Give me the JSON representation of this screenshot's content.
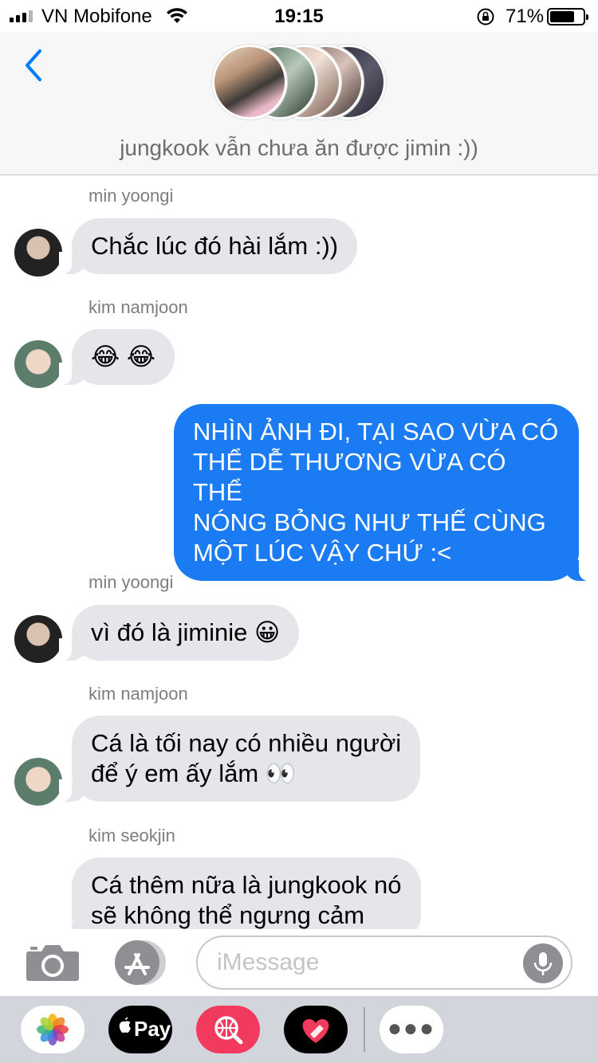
{
  "status_bar": {
    "carrier": "VN Mobifone",
    "time": "19:15",
    "battery_percent": "71%",
    "battery_level": 0.71,
    "signal_bars": 3
  },
  "header": {
    "back_icon": "chevron-left-icon",
    "group_title": "jungkook vẫn chưa ăn được jimin :))",
    "participant_count_shown": 5
  },
  "messages": [
    {
      "sender": "min yoongi",
      "direction": "incoming",
      "text": "Chắc lúc đó hài lắm :))"
    },
    {
      "sender": "kim namjoon",
      "direction": "incoming",
      "text": "😂 😂"
    },
    {
      "sender": "",
      "direction": "outgoing",
      "text_lines": [
        "NHÌN ẢNH ĐI, TẠI SAO VỪA CÓ",
        "THỂ DỄ THƯƠNG VỪA CÓ THỂ",
        "NÓNG BỎNG NHƯ THẾ CÙNG",
        "MỘT LÚC VẬY CHỨ :<"
      ]
    },
    {
      "sender": "min yoongi",
      "direction": "incoming",
      "text": "vì đó là jiminie 😀"
    },
    {
      "sender": "kim namjoon",
      "direction": "incoming",
      "text_lines": [
        "Cá là tối nay có nhiều người",
        "để ý em ấy lắm 👀"
      ]
    },
    {
      "sender": "kim seokjin",
      "direction": "incoming",
      "text_lines": [
        "Cá thêm nữa là jungkook nó",
        "sẽ không thể ngưng cảm"
      ]
    }
  ],
  "input_bar": {
    "placeholder": "iMessage",
    "value": "",
    "camera_icon": "camera-icon",
    "apps_icon": "app-store-icon",
    "mic_icon": "microphone-icon"
  },
  "app_drawer": {
    "photos_icon": "photos-icon",
    "apple_pay_label": "Pay",
    "search_icon": "web-search-icon",
    "digital_touch_icon": "heart-icon",
    "more_icon": "more-icon"
  },
  "colors": {
    "outgoing_bubble": "#1b7bf2",
    "incoming_bubble": "#e5e5ea",
    "accent": "#007aff"
  }
}
